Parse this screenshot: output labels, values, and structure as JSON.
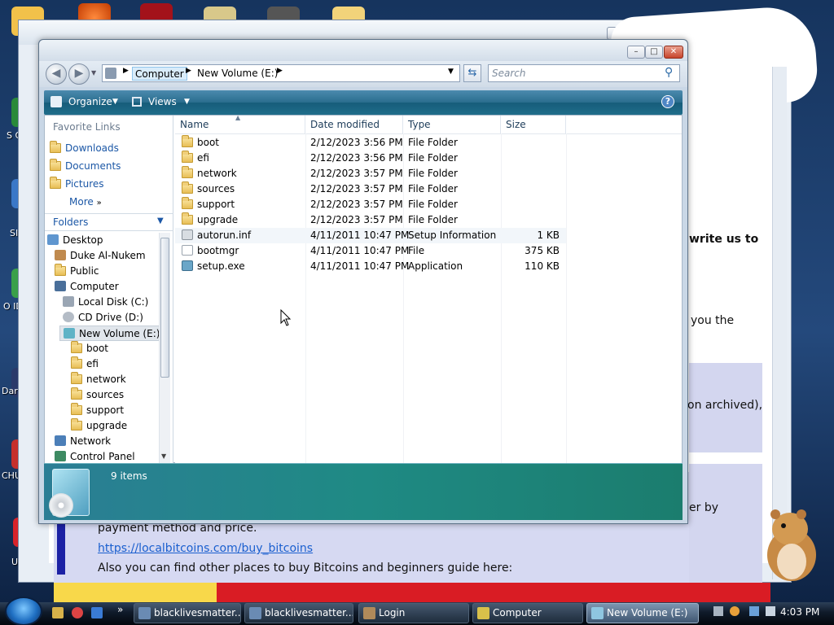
{
  "desktop": {
    "icon_labels": [
      "S OU",
      "SI",
      "O IDM",
      "Dark",
      "CHU",
      "UKRAIN"
    ]
  },
  "background_window": {
    "page_text": {
      "write_us": "write us to",
      "you_the": "you the",
      "archived": "on archived),",
      "er_by": "er by",
      "payment": "payment method and price.",
      "link": "https://localbitcoins.com/buy_bitcoins",
      "also": "Also you can find other places to buy Bitcoins and beginners guide here:"
    }
  },
  "explorer": {
    "nav": {
      "back": "◀",
      "forward": "▶"
    },
    "address": {
      "computer": "Computer",
      "volume": "New Volume (E:)"
    },
    "search": {
      "placeholder": "Search"
    },
    "toolbar": {
      "organize": "Organize",
      "views": "Views"
    },
    "favorite_links": {
      "header": "Favorite Links",
      "items": [
        "Downloads",
        "Documents",
        "Pictures"
      ],
      "more": "More"
    },
    "folders_header": "Folders",
    "tree": [
      "Desktop",
      "Duke Al-Nukem",
      "Public",
      "Computer",
      "Local Disk (C:)",
      "CD Drive (D:)",
      "New Volume (E:)",
      "boot",
      "efi",
      "network",
      "sources",
      "support",
      "upgrade",
      "Network",
      "Control Panel"
    ],
    "columns": [
      "Name",
      "Date modified",
      "Type",
      "Size"
    ],
    "files": [
      {
        "name": "boot",
        "date": "2/12/2023 3:56 PM",
        "type": "File Folder",
        "size": ""
      },
      {
        "name": "efi",
        "date": "2/12/2023 3:56 PM",
        "type": "File Folder",
        "size": ""
      },
      {
        "name": "network",
        "date": "2/12/2023 3:57 PM",
        "type": "File Folder",
        "size": ""
      },
      {
        "name": "sources",
        "date": "2/12/2023 3:57 PM",
        "type": "File Folder",
        "size": ""
      },
      {
        "name": "support",
        "date": "2/12/2023 3:57 PM",
        "type": "File Folder",
        "size": ""
      },
      {
        "name": "upgrade",
        "date": "2/12/2023 3:57 PM",
        "type": "File Folder",
        "size": ""
      },
      {
        "name": "autorun.inf",
        "date": "4/11/2011 10:47 PM",
        "type": "Setup Information",
        "size": "1 KB"
      },
      {
        "name": "bootmgr",
        "date": "4/11/2011 10:47 PM",
        "type": "File",
        "size": "375 KB"
      },
      {
        "name": "setup.exe",
        "date": "4/11/2011 10:47 PM",
        "type": "Application",
        "size": "110 KB"
      }
    ],
    "details": {
      "count": "9 items"
    }
  },
  "taskbar": {
    "items": [
      "blacklivesmatter...",
      "blacklivesmatter...",
      "Login",
      "Computer",
      "New Volume (E:)"
    ],
    "clock": "4:03 PM"
  }
}
